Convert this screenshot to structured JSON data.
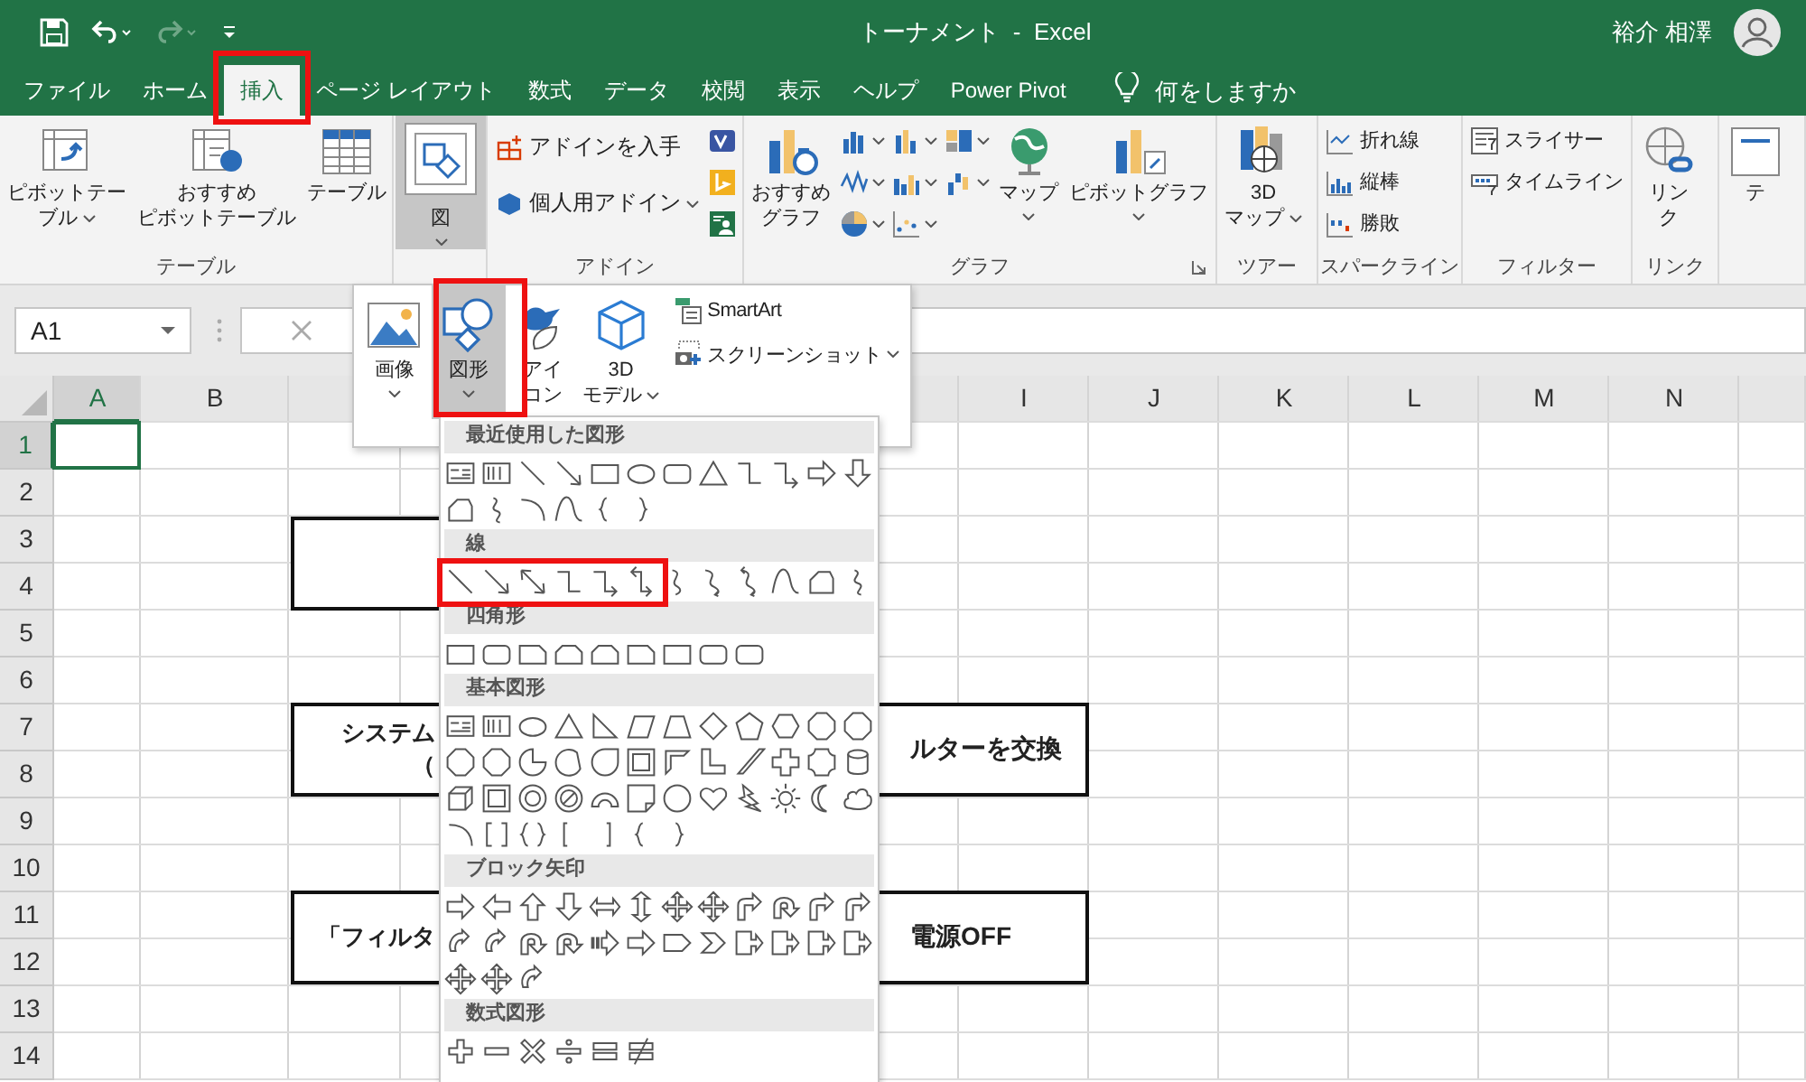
{
  "title_bar": {
    "title": "トーナメント  -  Excel",
    "user": "裕介 相澤"
  },
  "tabs": [
    {
      "label": "ファイル",
      "selected": false
    },
    {
      "label": "ホーム",
      "selected": false
    },
    {
      "label": "挿入",
      "selected": true
    },
    {
      "label": "ページ レイアウト",
      "selected": false
    },
    {
      "label": "数式",
      "selected": false
    },
    {
      "label": "データ",
      "selected": false
    },
    {
      "label": "校閲",
      "selected": false
    },
    {
      "label": "表示",
      "selected": false
    },
    {
      "label": "ヘルプ",
      "selected": false
    },
    {
      "label": "Power Pivot",
      "selected": false
    }
  ],
  "tell_me": {
    "placeholder": "何をしますか"
  },
  "ribbon": [
    {
      "label": "テーブル",
      "items": [
        {
          "kind": "large",
          "lines": [
            "ピボットテー",
            "ブル"
          ],
          "menu": true
        },
        {
          "kind": "large",
          "lines": [
            "おすすめ",
            "ピボットテーブル"
          ],
          "menu": false
        },
        {
          "kind": "large",
          "lines": [
            "テーブル"
          ],
          "menu": false
        }
      ]
    },
    {
      "items": [
        {
          "kind": "large",
          "lines": [
            "図"
          ],
          "menu": true,
          "expanded": true
        }
      ]
    },
    {
      "label": "アドイン",
      "items": [
        {
          "kind": "medium",
          "lines": [
            "アドインを入手"
          ],
          "menu": false
        },
        {
          "kind": "medium",
          "lines": [
            "個人用アドイン"
          ],
          "menu": true
        },
        {
          "kind": "icon",
          "menu": false
        },
        {
          "kind": "icon",
          "menu": false
        },
        {
          "kind": "icon",
          "menu": false
        }
      ]
    },
    {
      "label": "グラフ",
      "launcher": true,
      "items": [
        {
          "kind": "large",
          "lines": [
            "おすすめ",
            "グラフ"
          ],
          "menu": false
        },
        {
          "kind": "icon",
          "menu": true
        },
        {
          "kind": "icon",
          "menu": true
        },
        {
          "kind": "icon",
          "menu": true
        },
        {
          "kind": "icon",
          "menu": true
        },
        {
          "kind": "icon",
          "menu": true
        },
        {
          "kind": "icon",
          "menu": true
        },
        {
          "kind": "icon",
          "menu": true
        },
        {
          "kind": "icon",
          "menu": true
        },
        {
          "kind": "large",
          "lines": [
            "マップ"
          ],
          "menu": true
        },
        {
          "kind": "large",
          "lines": [
            "ピボットグラフ"
          ],
          "menu": true
        }
      ]
    },
    {
      "label": "ツアー",
      "items": [
        {
          "kind": "large",
          "lines": [
            "3D",
            "マップ"
          ],
          "menu": true
        }
      ]
    },
    {
      "label": "スパークライン",
      "items": [
        {
          "kind": "small",
          "lines": [
            "折れ線"
          ],
          "menu": false
        },
        {
          "kind": "small",
          "lines": [
            "縦棒"
          ],
          "menu": false
        },
        {
          "kind": "small",
          "lines": [
            "勝敗"
          ],
          "menu": false
        }
      ]
    },
    {
      "label": "フィルター",
      "items": [
        {
          "kind": "small",
          "lines": [
            "スライサー"
          ],
          "menu": false
        },
        {
          "kind": "small",
          "lines": [
            "タイムライン"
          ],
          "menu": false
        }
      ]
    },
    {
      "label": "リンク",
      "items": [
        {
          "kind": "large",
          "lines": [
            "リン",
            "ク"
          ],
          "menu": false
        }
      ]
    },
    {
      "items": [
        {
          "kind": "large",
          "lines": [
            "テ"
          ],
          "menu": false
        }
      ]
    }
  ],
  "formula_bar": {
    "name_box": "A1"
  },
  "insert_menu": {
    "items": [
      {
        "kind": "large",
        "lines": [
          "画像"
        ],
        "menu": true,
        "selected": false
      },
      {
        "kind": "large",
        "lines": [
          "図形"
        ],
        "menu": true,
        "selected": true
      },
      {
        "kind": "large",
        "lines": [
          "アイ",
          "コン"
        ],
        "menu": false,
        "selected": false
      },
      {
        "kind": "large",
        "lines": [
          "3D",
          "モデル"
        ],
        "menu": true,
        "selected": false
      },
      {
        "kind": "small",
        "lines": [
          "SmartArt"
        ],
        "menu": false,
        "selected": false
      },
      {
        "kind": "small",
        "lines": [
          "スクリーンショット"
        ],
        "menu": true,
        "selected": false
      }
    ]
  },
  "shapes_gallery": {
    "sections": [
      {
        "title": "最近使用した図形"
      },
      {
        "title": "線"
      },
      {
        "title": "四角形"
      },
      {
        "title": "基本図形"
      },
      {
        "title": "ブロック矢印"
      },
      {
        "title": "数式図形"
      }
    ]
  },
  "sheet": {
    "column_headers": [
      {
        "label": "A",
        "selected": true
      },
      {
        "label": "B",
        "selected": false
      },
      {
        "label": "I",
        "selected": false
      },
      {
        "label": "J",
        "selected": false
      },
      {
        "label": "K",
        "selected": false
      },
      {
        "label": "L",
        "selected": false
      },
      {
        "label": "M",
        "selected": false
      },
      {
        "label": "N",
        "selected": false
      }
    ],
    "row_headers": [
      {
        "label": "1",
        "selected": true
      },
      {
        "label": "2",
        "selected": false
      },
      {
        "label": "3",
        "selected": false
      },
      {
        "label": "4",
        "selected": false
      },
      {
        "label": "5",
        "selected": false
      },
      {
        "label": "6",
        "selected": false
      },
      {
        "label": "7",
        "selected": false
      },
      {
        "label": "8",
        "selected": false
      },
      {
        "label": "9",
        "selected": false
      },
      {
        "label": "10",
        "selected": false
      },
      {
        "label": "11",
        "selected": false
      },
      {
        "label": "12",
        "selected": false
      },
      {
        "label": "13",
        "selected": false
      },
      {
        "label": "14",
        "selected": false
      }
    ],
    "flow_boxes": [
      {
        "kind": "plain"
      },
      {
        "kind": "split",
        "left_lines": [
          "システム",
          "（"
        ],
        "right_text": "ルターを交換"
      },
      {
        "kind": "split",
        "left_lines": [
          "「フィルタ"
        ],
        "right_text": "電源OFF"
      }
    ]
  }
}
